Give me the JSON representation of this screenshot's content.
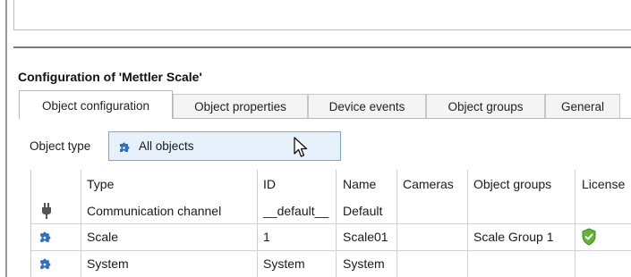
{
  "config_title": "Configuration of 'Mettler Scale'",
  "tabs": [
    {
      "label": "Object configuration",
      "active": true
    },
    {
      "label": "Object properties",
      "active": false
    },
    {
      "label": "Device events",
      "active": false
    },
    {
      "label": "Object groups",
      "active": false
    },
    {
      "label": "General",
      "active": false
    }
  ],
  "object_type": {
    "label": "Object type",
    "value": "All objects",
    "icon": "puzzle-icon"
  },
  "grid": {
    "columns": [
      "Type",
      "ID",
      "Name",
      "Cameras",
      "Object groups",
      "License"
    ],
    "rows": [
      {
        "icon": "plug-icon",
        "type": "Communication channel",
        "id": "__default__",
        "name": "Default",
        "cameras": "",
        "object_groups": "",
        "license": ""
      },
      {
        "icon": "puzzle-icon",
        "type": "Scale",
        "id": "1",
        "name": "Scale01",
        "cameras": "",
        "object_groups": "Scale Group 1",
        "license": "shield-check-icon"
      },
      {
        "icon": "puzzle-icon",
        "type": "System",
        "id": "System",
        "name": "System",
        "cameras": "",
        "object_groups": "",
        "license": ""
      }
    ]
  },
  "colors": {
    "selection": "#e6f1fb",
    "selection_border": "#7aa6d2",
    "puzzle": "#2d6fc7",
    "shield": "#62b533"
  }
}
